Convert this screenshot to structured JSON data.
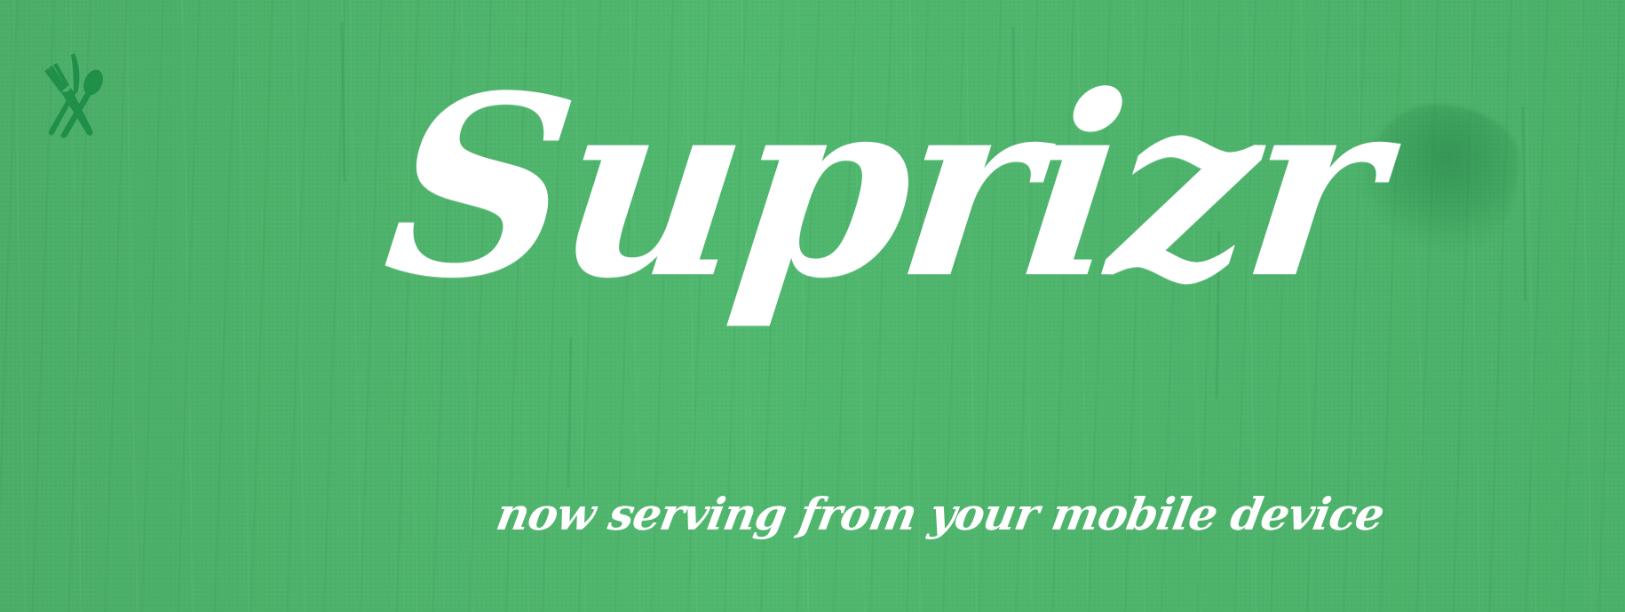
{
  "banner": {
    "brand_name": "Suprizr",
    "tagline": "now serving from your mobile device",
    "icon": "fork-knife-spoon-icon",
    "colors": {
      "background": "#4fb56d",
      "text": "#ffffff",
      "icon": "#1f8f49"
    }
  }
}
